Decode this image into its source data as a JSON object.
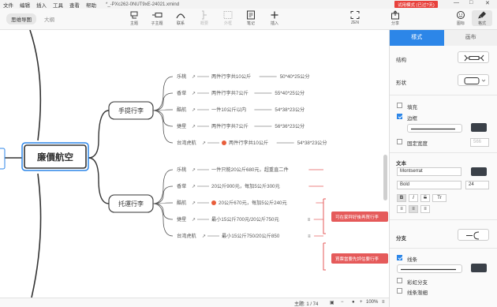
{
  "menubar": {
    "items": [
      "文件",
      "编辑",
      "插入",
      "工具",
      "查看",
      "帮助"
    ],
    "filename": "*_-PXc262-0NUT9xE-24021.xmind",
    "trial_badge": "试用模式 (已过?天)",
    "window_controls": [
      "—",
      "□",
      "✕"
    ]
  },
  "toolbar": {
    "view_tabs": [
      "思维导图",
      "大纲"
    ],
    "tools": [
      {
        "label": "主题",
        "icon": "topic-icon"
      },
      {
        "label": "子主题",
        "icon": "subtopic-icon"
      },
      {
        "label": "联系",
        "icon": "relationship-icon"
      },
      {
        "label": "概要",
        "icon": "summary-icon"
      },
      {
        "label": "外框",
        "icon": "boundary-icon"
      },
      {
        "label": "笔记",
        "icon": "note-icon"
      },
      {
        "label": "插入",
        "icon": "insert-icon"
      },
      {
        "label": "ZEN",
        "icon": "zen-icon"
      },
      {
        "label": "分享",
        "icon": "share-icon"
      },
      {
        "label": "图标",
        "icon": "sticker-icon"
      },
      {
        "label": "格式",
        "icon": "format-icon"
      }
    ]
  },
  "mindmap": {
    "central": "廉價航空",
    "branches": [
      {
        "label": "手提行李",
        "leaves": [
          {
            "airline": "乐桃",
            "rule": "两件行李共10公斤",
            "size": "50*40*25公分"
          },
          {
            "airline": "香草",
            "rule": "两件行李共7公斤",
            "size": "55*40*25公分"
          },
          {
            "airline": "酷航",
            "rule": "一件10公斤以内",
            "size": "54*38*23公分"
          },
          {
            "airline": "捷星",
            "rule": "两件行李共7公斤",
            "size": "56*36*23公分"
          },
          {
            "airline": "台湾虎航",
            "rule": "两件行李共10公斤",
            "size": "54*38*23公分"
          }
        ]
      },
      {
        "label": "托運行李",
        "leaves": [
          {
            "airline": "乐桃",
            "rule": "一件只能20公斤680元，超重直二件"
          },
          {
            "airline": "香草",
            "rule": "20公斤900元，每加5公斤300元"
          },
          {
            "airline": "酷航",
            "rule": "20公斤670元，每加5公斤240元"
          },
          {
            "airline": "捷星",
            "rule": "最小15公斤700元/20公斤750元"
          },
          {
            "airline": "台湾虎航",
            "rule": "最小15公斤750/20公斤850"
          }
        ],
        "callouts": [
          "可在家秤好後再買行李",
          "買票當要先評估要行李"
        ]
      }
    ]
  },
  "statusbar": {
    "topic_count": "主題: 1 / 74",
    "zoom": "100%"
  },
  "panel": {
    "tabs": [
      "樣式",
      "画布"
    ],
    "structure_label": "结构",
    "shape_label": "形状",
    "fill_label": "填充",
    "border_label": "边框",
    "fixed_width_label": "固定宽度",
    "fixed_width_value": "566",
    "text_section": "文本",
    "font_family": "Montserrat",
    "font_weight": "Bold",
    "font_size": "24",
    "branch_label": "分支",
    "line_label": "线条",
    "rainbow_label": "彩虹分支",
    "tapered_label": "线条渐细",
    "colors": {
      "accent": "#2c86e8",
      "swatch": "#3a4048",
      "callout": "#e55a5a"
    }
  }
}
